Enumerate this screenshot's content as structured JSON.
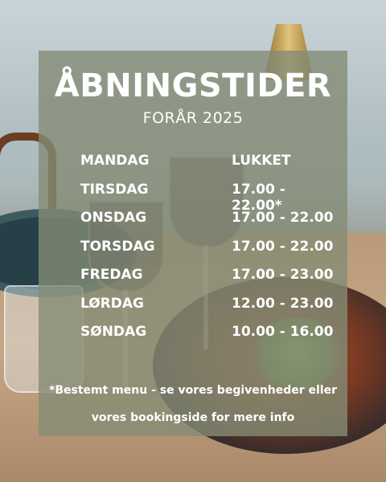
{
  "title": "ÅBNINGSTIDER",
  "subtitle": "FORÅR 2025",
  "hours": [
    {
      "day": "MANDAG",
      "time": "LUKKET"
    },
    {
      "day": "TIRSDAG",
      "time": "17.00 - 22.00*"
    },
    {
      "day": "ONSDAG",
      "time": "17.00 - 22.00"
    },
    {
      "day": "TORSDAG",
      "time": "17.00 - 22.00"
    },
    {
      "day": "FREDAG",
      "time": "17.00 - 23.00"
    },
    {
      "day": "LØRDAG",
      "time": "12.00 - 23.00"
    },
    {
      "day": "SØNDAG",
      "time": "10.00 - 16.00"
    }
  ],
  "note": {
    "line1": "*Bestemt menu - se vores begivenheder eller",
    "line2": "vores bookingside for mere info"
  },
  "colors": {
    "panel": "#848c76",
    "text": "#ffffff"
  }
}
